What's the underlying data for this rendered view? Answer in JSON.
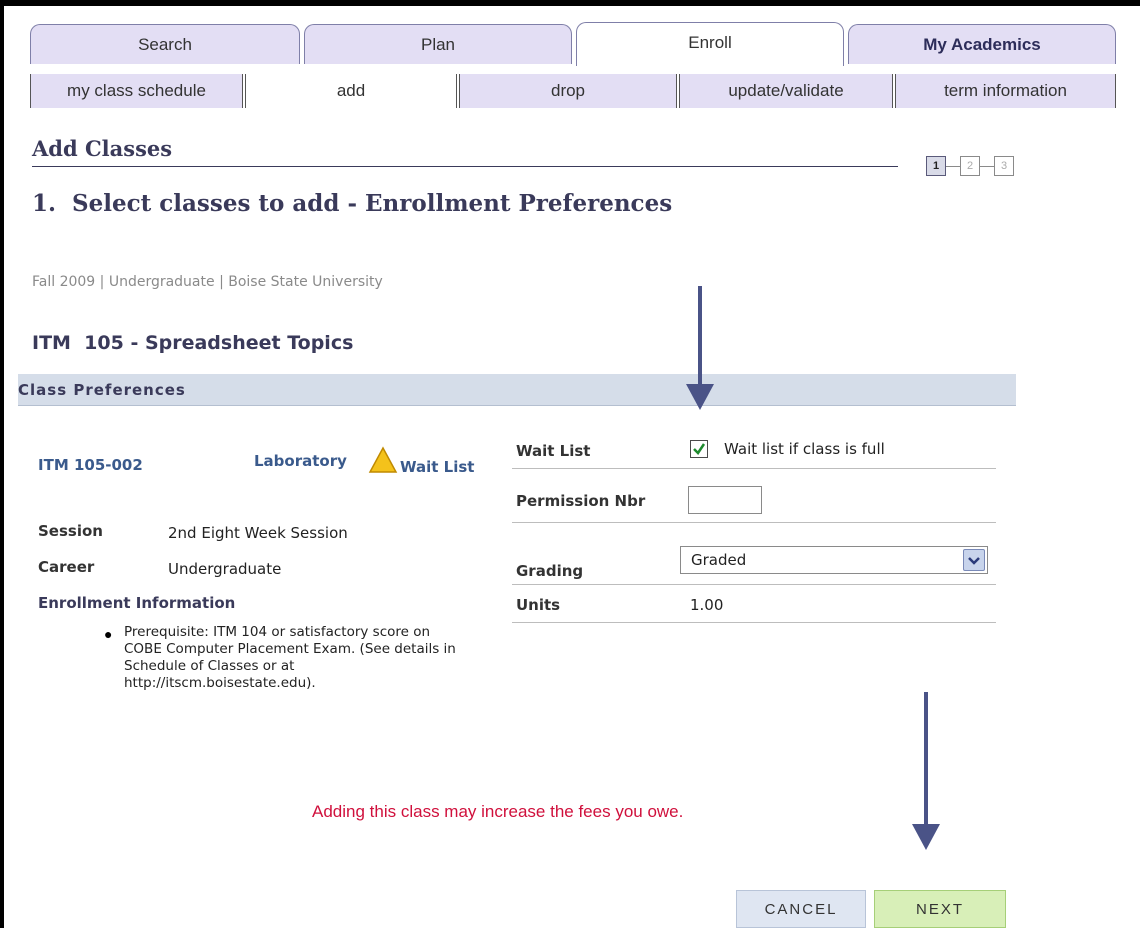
{
  "top_tabs": [
    {
      "label": "Search",
      "active": false
    },
    {
      "label": "Plan",
      "active": false
    },
    {
      "label": "Enroll",
      "active": true
    },
    {
      "label": "My Academics",
      "active": false
    }
  ],
  "sub_tabs": [
    {
      "label": "my class schedule"
    },
    {
      "label": "add"
    },
    {
      "label": "drop"
    },
    {
      "label": "update/validate"
    },
    {
      "label": "term information"
    }
  ],
  "page": {
    "title": "Add Classes",
    "step_heading": "1.  Select classes to add - Enrollment Preferences",
    "steps": [
      "1",
      "2",
      "3"
    ],
    "term_info": "Fall 2009 | Undergraduate | Boise State University",
    "course_title": "ITM  105 - Spreadsheet Topics"
  },
  "class_prefs": {
    "header": "Class Preferences",
    "section": "ITM 105-002",
    "component": "Laboratory",
    "wait_list_flag": "Wait List",
    "session_label": "Session",
    "session_value": "2nd Eight Week Session",
    "career_label": "Career",
    "career_value": "Undergraduate",
    "enroll_info_label": "Enrollment Information",
    "enroll_info_item": "Prerequisite: ITM 104 or satisfactory score on COBE Computer Placement Exam. (See details in Schedule of Classes or at http://itscm.boisestate.edu).",
    "waitlist_label": "Wait List",
    "waitlist_checkbox_label": "Wait list if class is full",
    "waitlist_checked": true,
    "permission_label": "Permission Nbr",
    "permission_value": "",
    "grading_label": "Grading",
    "grading_value": "Graded",
    "units_label": "Units",
    "units_value": "1.00"
  },
  "fee_warning": "Adding this class may increase the fees you owe.",
  "buttons": {
    "cancel": "Cancel",
    "next": "Next"
  },
  "colors": {
    "tab_bg": "#e3def4",
    "header_band": "#d5dde9",
    "link": "#3a5a8c",
    "warning_text": "#d0103c",
    "arrow": "#4a5387",
    "next_button": "#d8efb8",
    "cancel_button": "#dfe6f2"
  },
  "icons": {
    "warning": "warning-triangle-icon",
    "checkbox": "checkmark-icon",
    "dropdown": "chevron-down-icon"
  }
}
